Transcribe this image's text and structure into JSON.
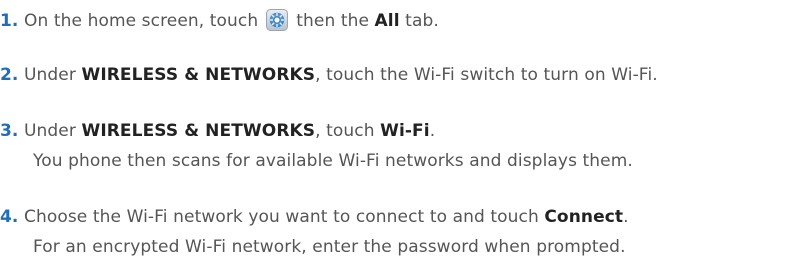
{
  "steps": [
    {
      "num": "1.",
      "t1": " On the home screen, touch ",
      "icon": "settings-gear-icon",
      "t2": " then the ",
      "b1": "All",
      "t3": " tab."
    },
    {
      "num": "2.",
      "t1": " Under ",
      "b1": "WIRELESS & NETWORKS",
      "t2": ", touch the Wi-Fi switch to turn on Wi-Fi."
    },
    {
      "num": "3.",
      "t1": " Under ",
      "b1": "WIRELESS & NETWORKS",
      "t2": ", touch ",
      "b2": "Wi-Fi",
      "t3": ".",
      "sub": "You phone then scans for available Wi-Fi networks and displays them."
    },
    {
      "num": "4.",
      "t1": " Choose the Wi-Fi network you want to connect to and touch ",
      "b1": "Connect",
      "t2": ".",
      "sub": "For an encrypted Wi-Fi network, enter the password when prompted."
    }
  ],
  "colors": {
    "number": "#1f6fb8",
    "text": "#555555",
    "bold": "#222222",
    "icon_blue": "#3d86c6"
  }
}
